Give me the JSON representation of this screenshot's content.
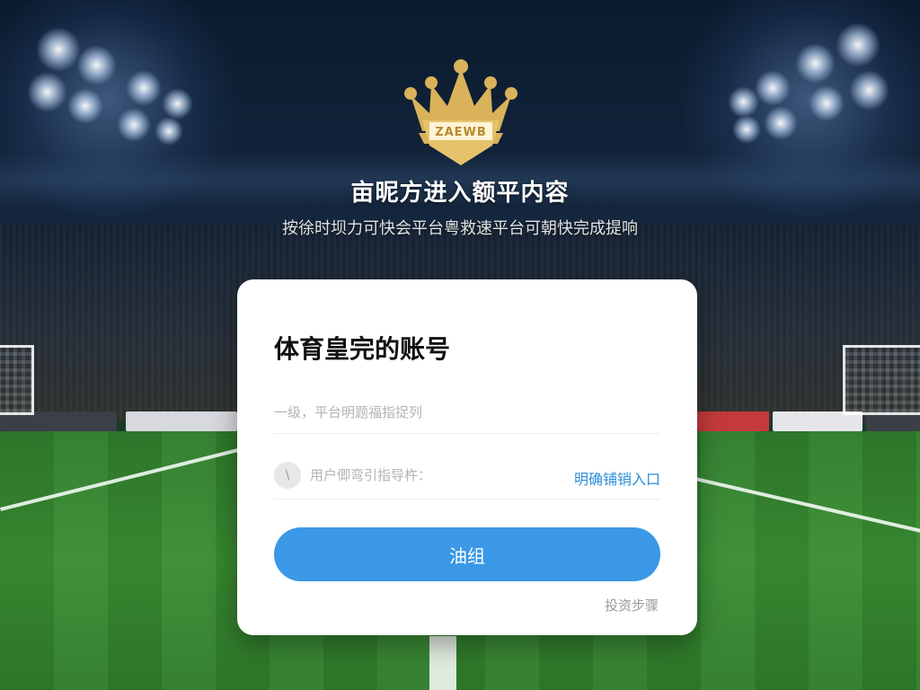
{
  "hero": {
    "logo_text": "ZAEWB",
    "headline": "亩昵方进入额平内容",
    "subline": "按徐时坝力可快会平台粤救速平台可朝快完成提响"
  },
  "login_card": {
    "title": "体育皇完的账号",
    "account_placeholder": "一级，平台明题福指捉列",
    "password_placeholder": "用户㑡弯引指导杵：",
    "password_icon": "\\",
    "entry_link": "明确铺销入口",
    "submit_label": "油组",
    "help_link": "投资步骤"
  },
  "colors": {
    "accent": "#3a98e6",
    "link": "#2b8fd9",
    "logo_gold": "#d9b25a"
  }
}
